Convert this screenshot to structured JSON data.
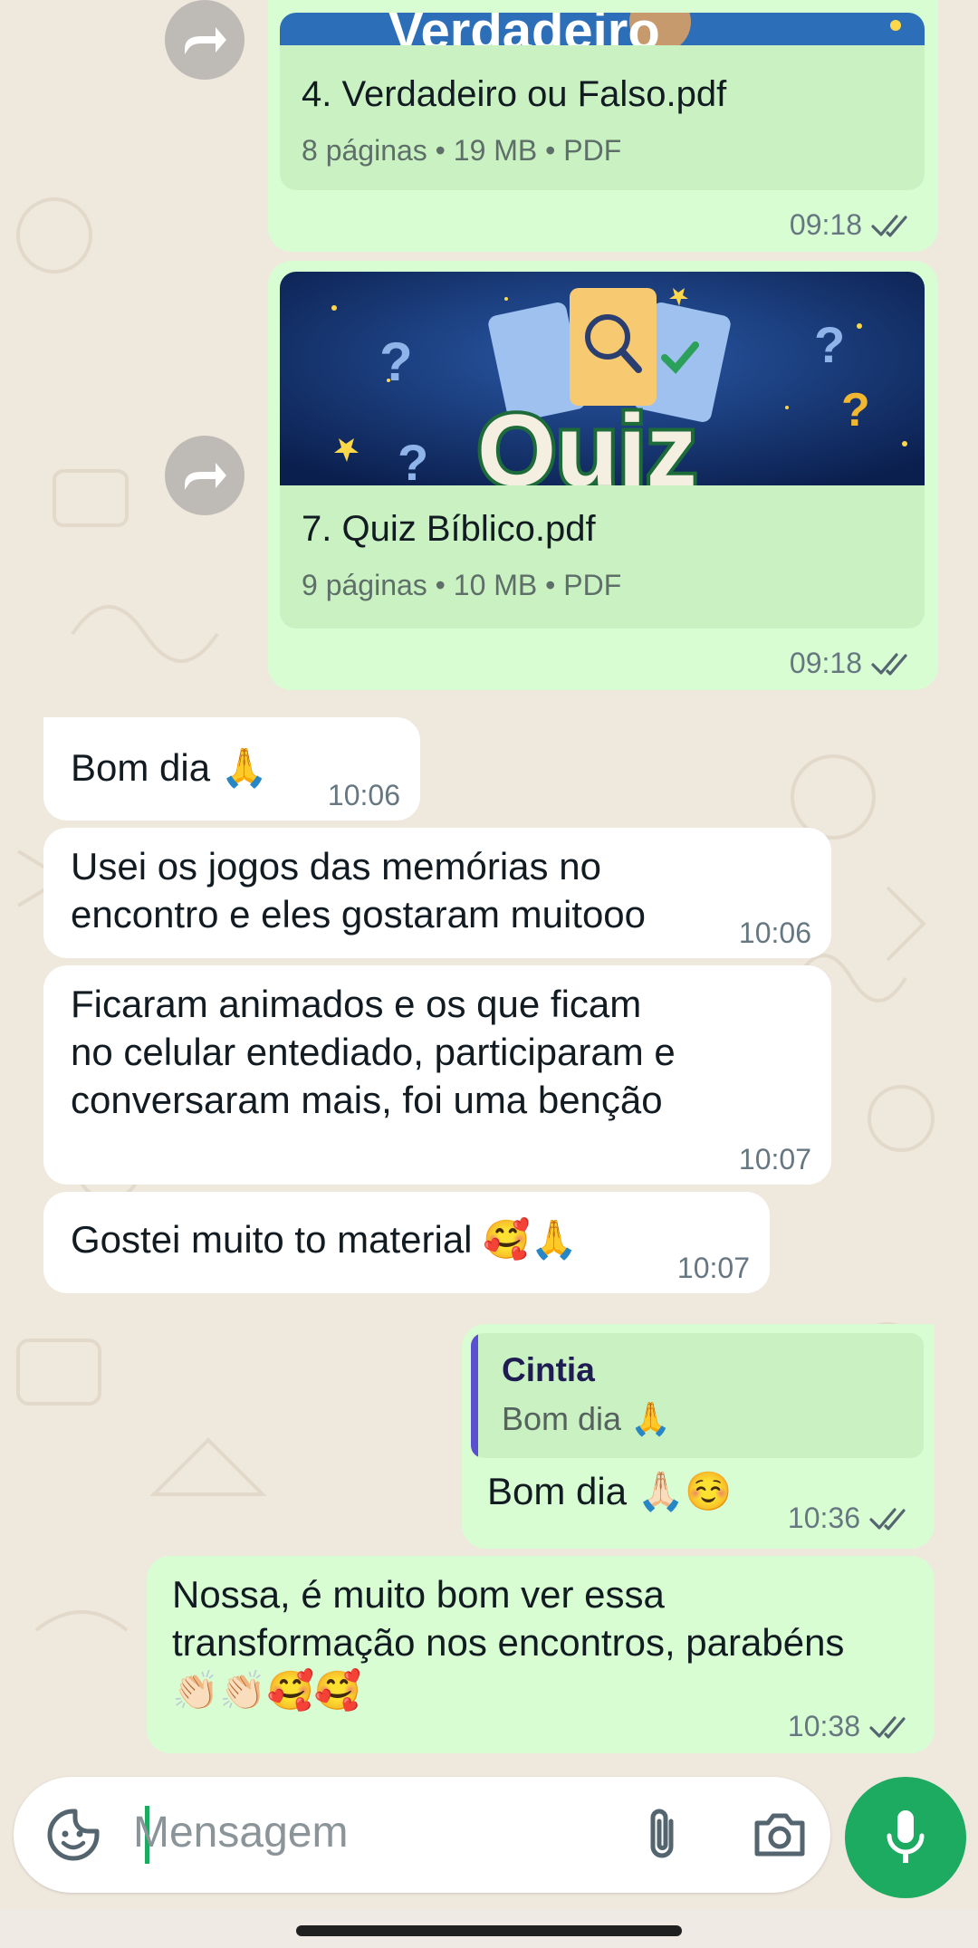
{
  "messages": [
    {
      "type": "document",
      "direction": "outgoing",
      "forwarded": true,
      "thumb_text": "Verdadeiro",
      "name": "4. Verdadeiro ou Falso.pdf",
      "info": "8 páginas • 19 MB • PDF",
      "time": "09:18",
      "status": "read"
    },
    {
      "type": "document",
      "direction": "outgoing",
      "forwarded": true,
      "thumb_text": "Quiz",
      "name": "7. Quiz Bíblico.pdf",
      "info": "9 páginas • 10 MB • PDF",
      "time": "09:18",
      "status": "read"
    },
    {
      "type": "text",
      "direction": "incoming",
      "text": "Bom dia 🙏",
      "time": "10:06"
    },
    {
      "type": "text",
      "direction": "incoming",
      "text": "Usei os jogos das memórias no\nencontro e eles gostaram muitooo",
      "time": "10:06"
    },
    {
      "type": "text",
      "direction": "incoming",
      "text": "Ficaram animados e os que ficam\nno celular entediado, participaram e\nconversaram mais, foi uma benção",
      "time": "10:07"
    },
    {
      "type": "text",
      "direction": "incoming",
      "text": "Gostei muito to material 🥰🙏",
      "time": "10:07"
    },
    {
      "type": "reply",
      "direction": "outgoing",
      "quoted_name": "Cintia",
      "quoted_text": "Bom dia 🙏",
      "text": "Bom dia 🙏🏻☺️",
      "time": "10:36",
      "status": "read"
    },
    {
      "type": "text",
      "direction": "outgoing",
      "text": "Nossa, é muito bom ver essa\ntransformação nos encontros, parabéns\n👏🏻👏🏻🥰🥰",
      "time": "10:38",
      "status": "read"
    }
  ],
  "composer": {
    "placeholder": "Mensagem",
    "icons": [
      "sticker-icon",
      "paperclip-icon",
      "camera-icon",
      "microphone-icon"
    ]
  },
  "colors": {
    "outgoing_bubble": "#d9fdd3",
    "incoming_bubble": "#ffffff",
    "wallpaper": "#efe8dd",
    "accent_green": "#1daa61",
    "read_ticks": "#54656f"
  }
}
